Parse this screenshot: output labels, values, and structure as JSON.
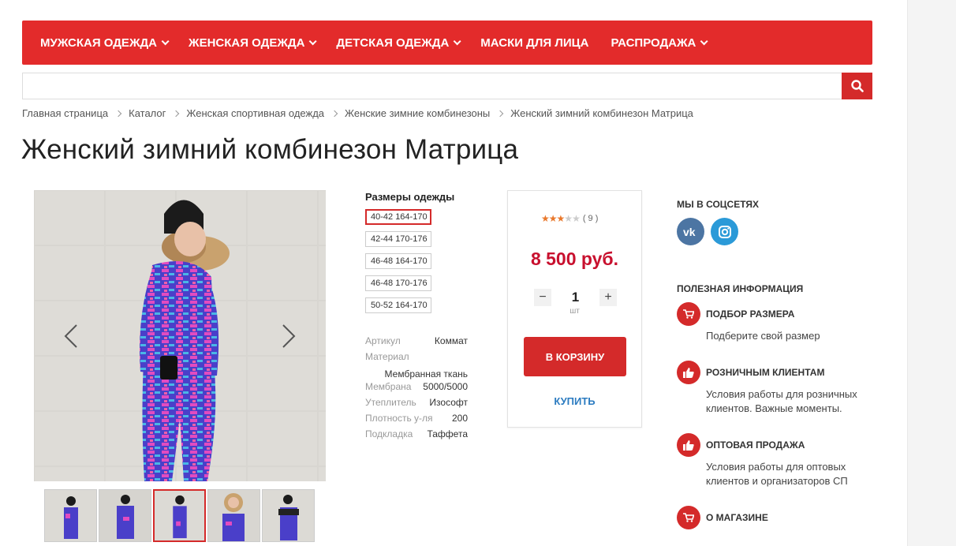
{
  "nav": {
    "items": [
      {
        "label": "МУЖСКАЯ ОДЕЖДА",
        "dropdown": true
      },
      {
        "label": "ЖЕНСКАЯ ОДЕЖДА",
        "dropdown": true
      },
      {
        "label": "ДЕТСКАЯ ОДЕЖДА",
        "dropdown": true
      },
      {
        "label": "МАСКИ ДЛЯ ЛИЦА",
        "dropdown": false
      },
      {
        "label": "РАСПРОДАЖА",
        "dropdown": true
      }
    ]
  },
  "search": {
    "placeholder": "",
    "value": ""
  },
  "breadcrumb": [
    "Главная страница",
    "Каталог",
    "Женская спортивная одежда",
    "Женские зимние комбинезоны",
    "Женский зимний комбинезон Матрица"
  ],
  "product": {
    "title": "Женский зимний комбинезон Матрица",
    "sizes_title": "Размеры одежды",
    "sizes": [
      "40-42 164-170",
      "42-44 170-176",
      "46-48 164-170",
      "46-48 170-176",
      "50-52 164-170"
    ],
    "selected_size": 0,
    "specs": [
      {
        "key": "Артикул",
        "value": "Коммат"
      },
      {
        "key": "Материал",
        "value": "Мембранная ткань"
      },
      {
        "key": "Мембрана",
        "value": "5000/5000"
      },
      {
        "key": "Утеплитель",
        "value": "Изософт"
      },
      {
        "key": "Плотность у-ля",
        "value": "200"
      },
      {
        "key": "Подкладка",
        "value": "Таффета"
      }
    ],
    "thumbnails_count": 5,
    "active_thumbnail": 2
  },
  "buy_box": {
    "rating_stars": 3,
    "rating_max": 5,
    "rating_count": "( 9 )",
    "price": "8 500 руб.",
    "quantity": "1",
    "unit": "шт",
    "cart_label": "В КОРЗИНУ",
    "buy_label": "КУПИТЬ"
  },
  "sidebar": {
    "social_heading": "МЫ В СОЦСЕТЯХ",
    "social": [
      "vk-icon",
      "instagram-icon"
    ],
    "info_heading": "ПОЛЕЗНАЯ ИНФОРМАЦИЯ",
    "info_items": [
      {
        "title": "ПОДБОР РАЗМЕРА",
        "desc": "Подберите свой размер",
        "icon": "cart-icon"
      },
      {
        "title": "РОЗНИЧНЫМ КЛИЕНТАМ",
        "desc": "Условия работы для розничных клиентов. Важные моменты.",
        "icon": "thumbs-up-icon"
      },
      {
        "title": "ОПТОВАЯ ПРОДАЖА",
        "desc": "Условия работы для оптовых клиентов и организаторов СП",
        "icon": "thumbs-up-icon"
      },
      {
        "title": "О МАГАЗИНЕ",
        "desc": "",
        "icon": "cart-icon"
      }
    ]
  },
  "colors": {
    "accent": "#e32b2b",
    "price": "#c8102e",
    "link": "#2b7bc0",
    "star": "#e9782b"
  }
}
